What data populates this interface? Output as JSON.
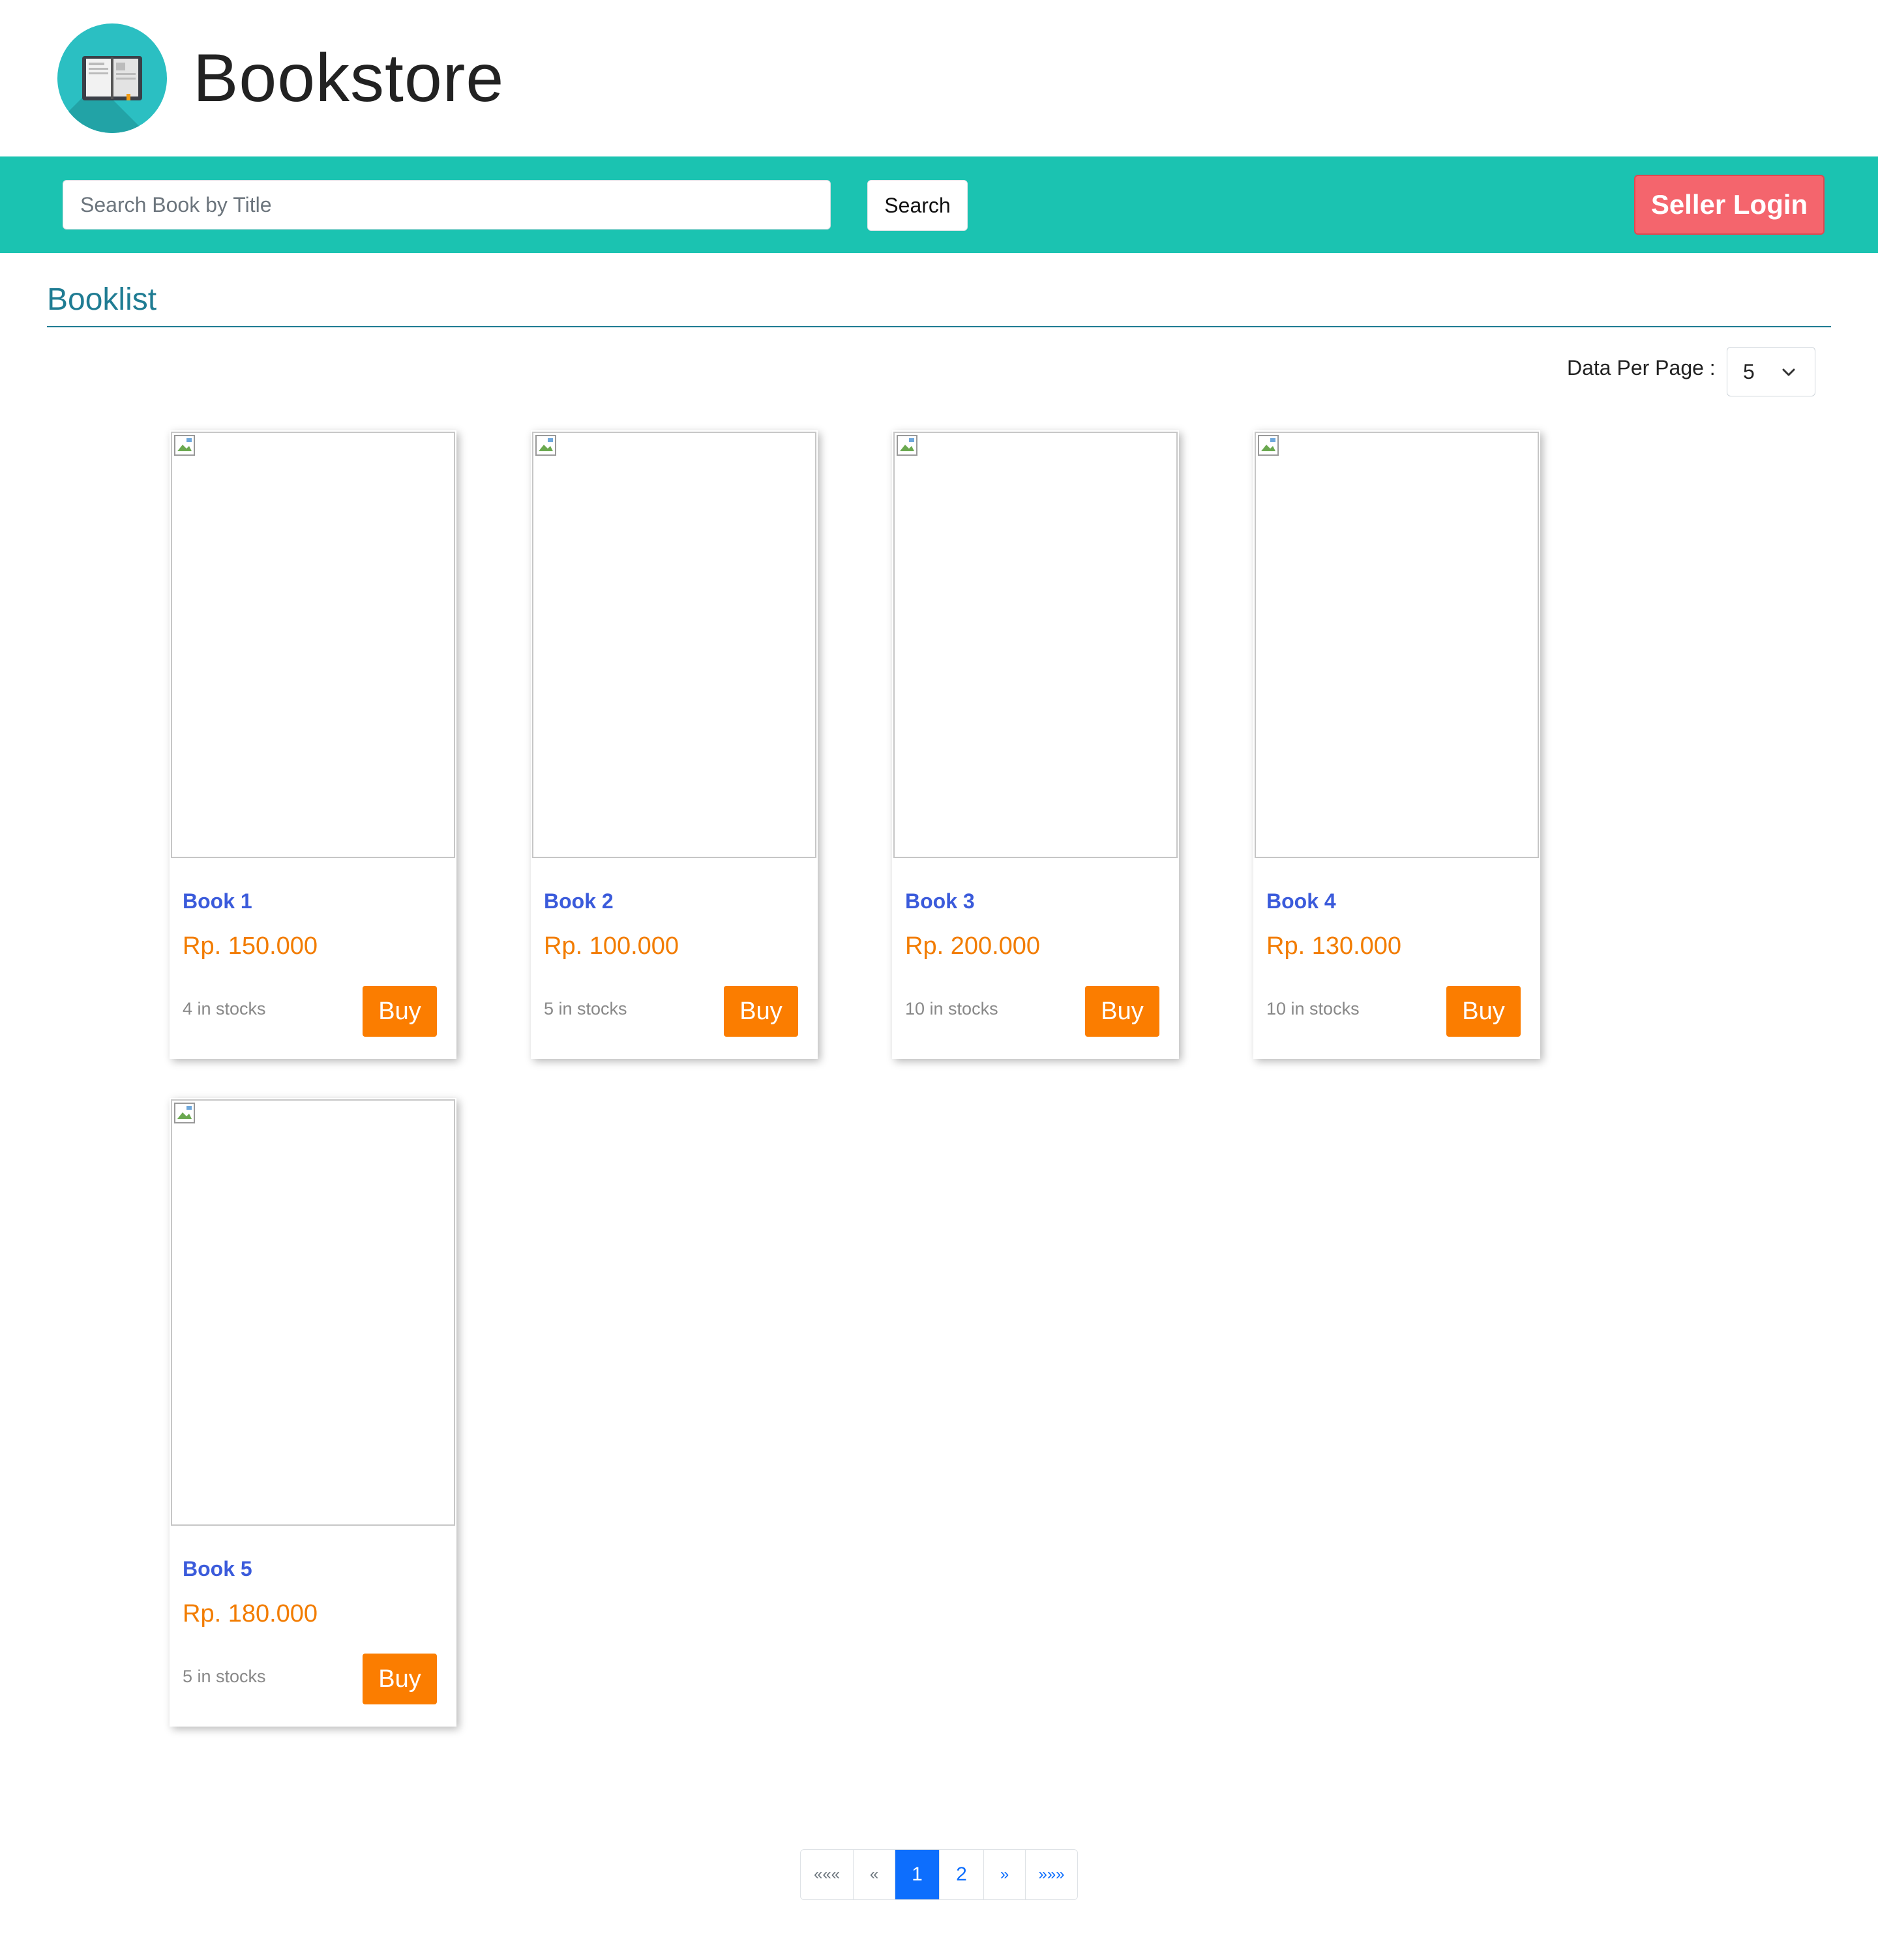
{
  "header": {
    "title": "Bookstore"
  },
  "navbar": {
    "search_placeholder": "Search Book by Title",
    "search_value": "",
    "search_button": "Search",
    "seller_login_button": "Seller Login"
  },
  "section": {
    "title": "Booklist"
  },
  "per_page": {
    "label": "Data Per Page :",
    "selected": "5"
  },
  "books": [
    {
      "title": "Book 1",
      "price": "Rp. 150.000",
      "stock": "4 in stocks",
      "buy_label": "Buy"
    },
    {
      "title": "Book 2",
      "price": "Rp. 100.000",
      "stock": "5 in stocks",
      "buy_label": "Buy"
    },
    {
      "title": "Book 3",
      "price": "Rp. 200.000",
      "stock": "10 in stocks",
      "buy_label": "Buy"
    },
    {
      "title": "Book 4",
      "price": "Rp. 130.000",
      "stock": "10 in stocks",
      "buy_label": "Buy"
    },
    {
      "title": "Book 5",
      "price": "Rp. 180.000",
      "stock": "5 in stocks",
      "buy_label": "Buy"
    }
  ],
  "pagination": {
    "first": "«««",
    "prev": "«",
    "pages": [
      "1",
      "2"
    ],
    "active_page": "1",
    "next": "»",
    "last": "»»»"
  },
  "colors": {
    "navbar": "#1bc3b1",
    "seller_button": "#f4656d",
    "accent_title": "#1f7c93",
    "book_title": "#3b5bdb",
    "price": "#f27c00",
    "buy_button": "#fb7d00",
    "page_active": "#0d6efd"
  },
  "icons": {
    "logo": "open-book-icon",
    "select": "chevron-down-icon",
    "image": "broken-image-icon"
  }
}
